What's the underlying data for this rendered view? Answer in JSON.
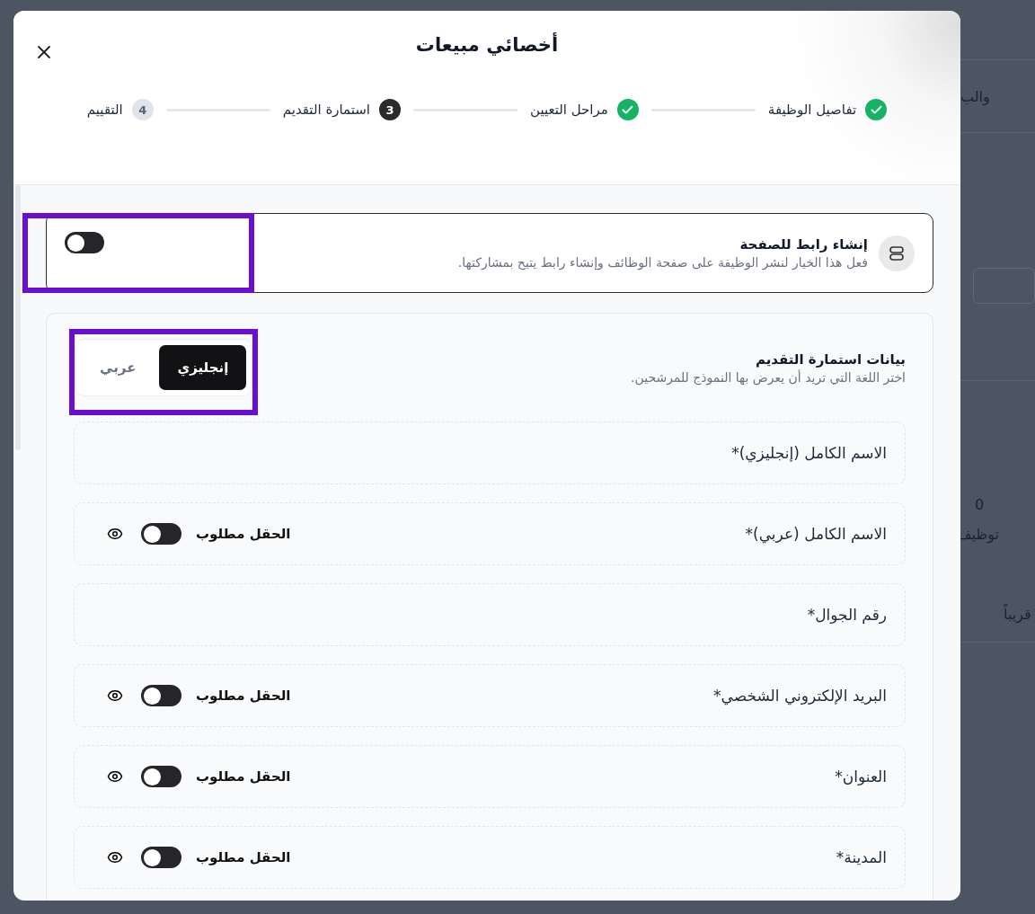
{
  "background_page": {
    "texts": [
      "والب",
      "0",
      "توظيف",
      "قريباً"
    ]
  },
  "modal": {
    "title": "أخصائي مبيعات",
    "steps": [
      {
        "label": "تفاصيل الوظيفة",
        "done": true,
        "current": false
      },
      {
        "label": "مراحل التعيين",
        "done": true,
        "current": false
      },
      {
        "label": "استمارة التقديم",
        "done": false,
        "current": true,
        "number": "3"
      },
      {
        "label": "التقييم",
        "done": false,
        "current": false,
        "number": "4"
      }
    ],
    "page_link": {
      "title": "إنشاء رابط للصفحة",
      "description": "فعل هذا الخيار لنشر الوظيفة على صفحة الوظائف وإنشاء رابط يتيح بمشاركتها.",
      "on": false,
      "highlighted": true
    },
    "form_section": {
      "title": "بيانات استمارة التقديم",
      "description": "اختر اللغة التي تريد أن يعرض بها النموذج للمرشحين.",
      "highlighted": true,
      "languages": [
        {
          "label": "إنجليزي",
          "selected": true
        },
        {
          "label": "عربي",
          "selected": false
        }
      ],
      "fields": [
        {
          "label": "الاسم الكامل (إنجليزي)*",
          "kind": "fixed"
        },
        {
          "label": "الاسم الكامل (عربي)*",
          "kind": "optional",
          "required_label": "الحقل مطلوب",
          "required": false
        },
        {
          "label": "رقم الجوال*",
          "kind": "fixed"
        },
        {
          "label": "البريد الإلكتروني الشخصي*",
          "kind": "optional",
          "required_label": "الحقل مطلوب",
          "required": false
        },
        {
          "label": "العنوان*",
          "kind": "optional",
          "required_label": "الحقل مطلوب",
          "required": false
        },
        {
          "label": "المدينة*",
          "kind": "optional",
          "required_label": "الحقل مطلوب",
          "required": false
        }
      ]
    }
  }
}
